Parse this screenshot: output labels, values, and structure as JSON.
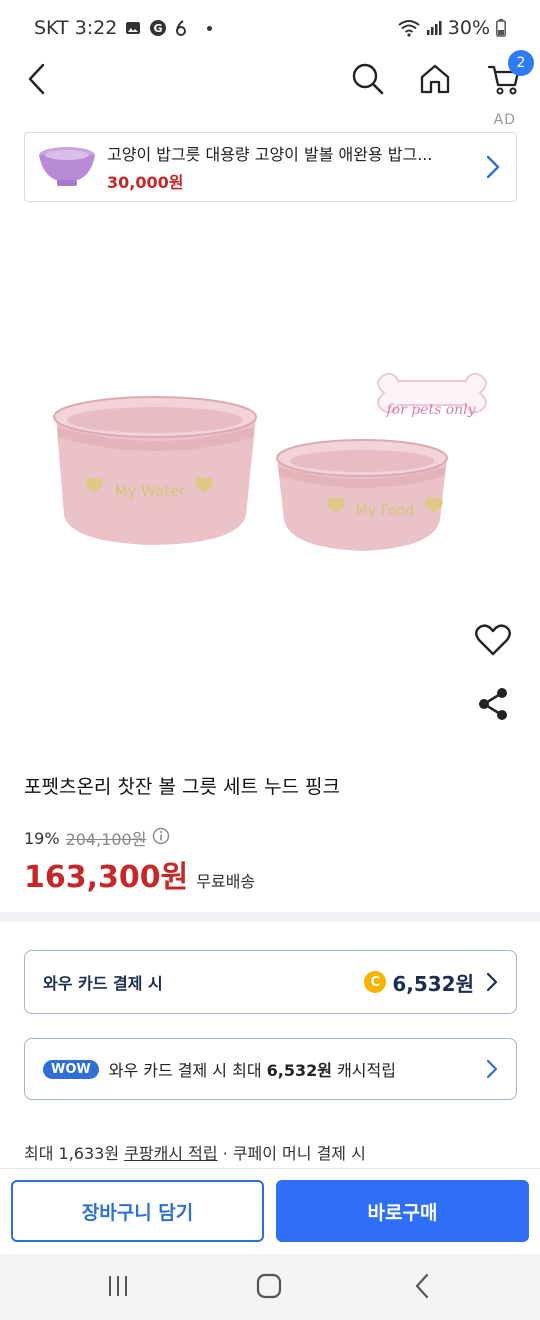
{
  "status_bar": {
    "carrier_time": "SKT 3:22",
    "battery": "30%",
    "icons": [
      "image-icon",
      "g-icon",
      "six-icon",
      "notification-dot",
      "wifi-icon",
      "signal-icon",
      "battery-icon"
    ]
  },
  "nav": {
    "icons": [
      "back-icon",
      "search-icon",
      "home-icon",
      "cart-icon"
    ],
    "cart_count": "2"
  },
  "ad": {
    "label": "AD",
    "title": "고양이 밥그릇 대용량 고양이 발볼 애완용 밥그...",
    "price": "30,000원"
  },
  "product_image": {
    "bowl1_text": "My Water",
    "bowl2_text": "My Food",
    "logo_text": "for pets only"
  },
  "product": {
    "title": "포펫츠온리 찻잔 볼 그릇 세트 누드 핑크",
    "discount": "19%",
    "original_price": "204,100원",
    "price": "163,300원",
    "shipping": "무료배송"
  },
  "benefits": {
    "card_label": "와우 카드 결제 시",
    "card_amount": "6,532원",
    "coin_letter": "C",
    "wow_badge": "WOW",
    "wow_text_1": "와우 카드 결제 시 최대 ",
    "wow_text_amount": "6,532원",
    "wow_text_2": " 캐시적립"
  },
  "cash": {
    "prefix": "최대 1,633원 ",
    "link": "쿠팡캐시 적립",
    "suffix": " · 쿠페이 머니 결제 시"
  },
  "actions": {
    "cart_button": "장바구니 담기",
    "buy_button": "바로구매"
  },
  "colors": {
    "accent_blue": "#2f6ff6",
    "price_red": "#c62828"
  }
}
